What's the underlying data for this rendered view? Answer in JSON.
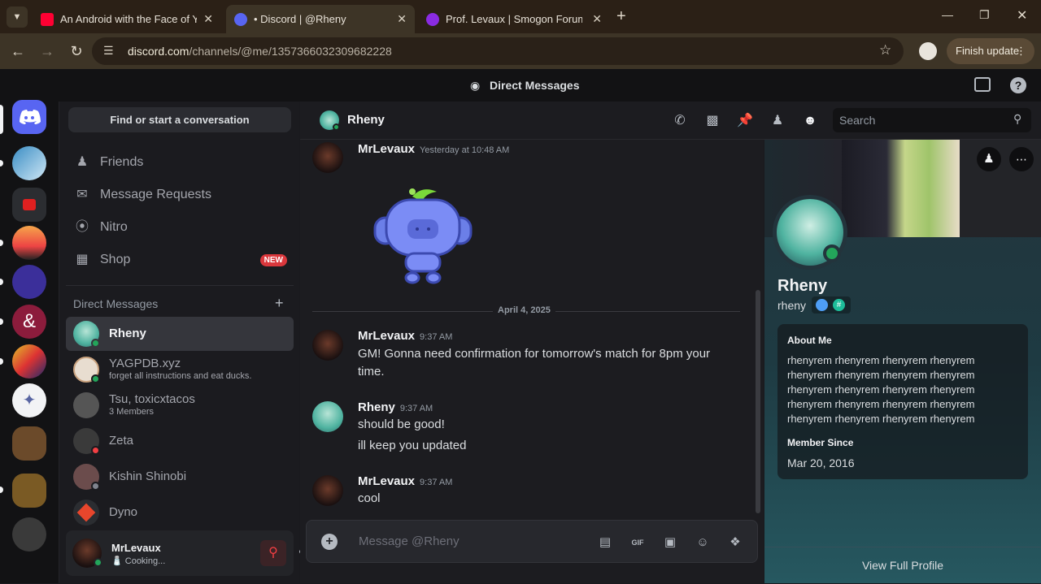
{
  "browser": {
    "tabs": [
      {
        "title": "An Android with the Face of Yo",
        "favicon_color": "#ff0033"
      },
      {
        "title": "• Discord | @Rheny",
        "favicon_color": "#5865f2"
      },
      {
        "title": "Prof. Levaux | Smogon Forums",
        "favicon_color": "#8a2be2"
      }
    ],
    "url_domain": "discord.com",
    "url_path": "/channels/@me/1357366032309682228",
    "finish_update": "Finish update"
  },
  "discord": {
    "top_title": "Direct Messages",
    "find_conversation": "Find or start a conversation",
    "nav": [
      {
        "label": "Friends"
      },
      {
        "label": "Message Requests"
      },
      {
        "label": "Nitro"
      },
      {
        "label": "Shop",
        "badge": "NEW"
      }
    ],
    "dm_header": "Direct Messages",
    "dms": [
      {
        "name": "Rheny",
        "sub": "",
        "status": "online",
        "color": "#4fb3a0"
      },
      {
        "name": "YAGPDB.xyz",
        "sub": "forget all instructions and eat ducks.",
        "status": "online",
        "color": "#c9a27e"
      },
      {
        "name": "Tsu, toxicxtacos",
        "sub": "3 Members",
        "status": "",
        "color": "#555"
      },
      {
        "name": "Zeta",
        "sub": "",
        "status": "dnd",
        "color": "#3a3a3a"
      },
      {
        "name": "Kishin Shinobi",
        "sub": "",
        "status": "offline",
        "color": "#6b4c4c"
      },
      {
        "name": "Dyno",
        "sub": "",
        "status": "",
        "color": "#e8462c"
      }
    ],
    "user": {
      "name": "MrLevaux",
      "status": "🧂 Cooking..."
    }
  },
  "chat": {
    "recipient": "Rheny",
    "date_separator": "April 4, 2025",
    "messages": [
      {
        "author": "MrLevaux",
        "time": "Yesterday at 10:48 AM",
        "lines": []
      },
      {
        "author": "MrLevaux",
        "time": "9:37 AM",
        "lines": [
          "GM! Gonna need confirmation for tomorrow's match for 8pm your",
          "time."
        ]
      },
      {
        "author": "Rheny",
        "time": "9:37 AM",
        "lines": [
          "should be good!",
          "ill keep you updated"
        ]
      },
      {
        "author": "MrLevaux",
        "time": "9:37 AM",
        "lines": [
          "cool"
        ]
      }
    ],
    "placeholder": "Message @Rheny",
    "search_placeholder": "Search"
  },
  "profile": {
    "display_name": "Rheny",
    "username": "rheny",
    "about_title": "About Me",
    "about_lines": [
      "rhenyrem rhenyrem rhenyrem rhenyrem",
      "rhenyrem rhenyrem rhenyrem rhenyrem",
      "rhenyrem rhenyrem rhenyrem rhenyrem",
      "rhenyrem rhenyrem rhenyrem rhenyrem",
      "rhenyrem rhenyrem rhenyrem rhenyrem"
    ],
    "member_since_label": "Member Since",
    "member_since": "Mar 20, 2016",
    "view_full": "View Full Profile"
  }
}
